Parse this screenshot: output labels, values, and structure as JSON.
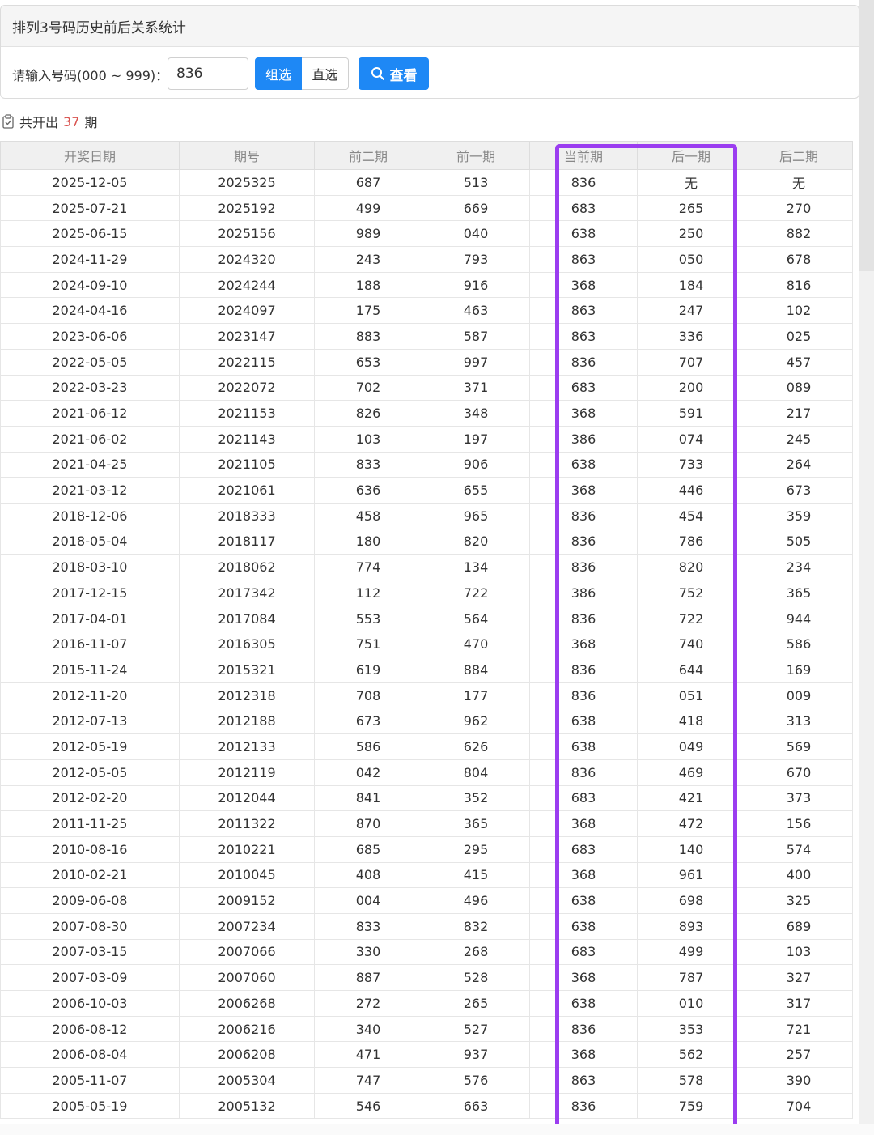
{
  "panel": {
    "title": "排列3号码历史前后关系统计",
    "search_label": "请输入号码(000 ~ 999)：",
    "search_value": "836",
    "modes": [
      "组选",
      "直选"
    ],
    "active_mode": "组选",
    "search_button": "查看",
    "search_icon": "search-icon"
  },
  "summary": {
    "prefix": "共开出",
    "count": "37",
    "suffix": "期",
    "icon": "clipboard-check-icon"
  },
  "colors": {
    "accent": "#1e88f5",
    "count": "#d9534f",
    "highlight": "#9b3df0"
  },
  "table": {
    "headers": [
      "开奖日期",
      "期号",
      "前二期",
      "前一期",
      "当前期",
      "后一期",
      "后二期"
    ],
    "rows": [
      [
        "2025-12-05",
        "2025325",
        "687",
        "513",
        "836",
        "无",
        "无"
      ],
      [
        "2025-07-21",
        "2025192",
        "499",
        "669",
        "683",
        "265",
        "270"
      ],
      [
        "2025-06-15",
        "2025156",
        "989",
        "040",
        "638",
        "250",
        "882"
      ],
      [
        "2024-11-29",
        "2024320",
        "243",
        "793",
        "863",
        "050",
        "678"
      ],
      [
        "2024-09-10",
        "2024244",
        "188",
        "916",
        "368",
        "184",
        "816"
      ],
      [
        "2024-04-16",
        "2024097",
        "175",
        "463",
        "863",
        "247",
        "102"
      ],
      [
        "2023-06-06",
        "2023147",
        "883",
        "587",
        "863",
        "336",
        "025"
      ],
      [
        "2022-05-05",
        "2022115",
        "653",
        "997",
        "836",
        "707",
        "457"
      ],
      [
        "2022-03-23",
        "2022072",
        "702",
        "371",
        "683",
        "200",
        "089"
      ],
      [
        "2021-06-12",
        "2021153",
        "826",
        "348",
        "368",
        "591",
        "217"
      ],
      [
        "2021-06-02",
        "2021143",
        "103",
        "197",
        "386",
        "074",
        "245"
      ],
      [
        "2021-04-25",
        "2021105",
        "833",
        "906",
        "638",
        "733",
        "264"
      ],
      [
        "2021-03-12",
        "2021061",
        "636",
        "655",
        "368",
        "446",
        "673"
      ],
      [
        "2018-12-06",
        "2018333",
        "458",
        "965",
        "836",
        "454",
        "359"
      ],
      [
        "2018-05-04",
        "2018117",
        "180",
        "820",
        "836",
        "786",
        "505"
      ],
      [
        "2018-03-10",
        "2018062",
        "774",
        "134",
        "836",
        "820",
        "234"
      ],
      [
        "2017-12-15",
        "2017342",
        "112",
        "722",
        "386",
        "752",
        "365"
      ],
      [
        "2017-04-01",
        "2017084",
        "553",
        "564",
        "836",
        "722",
        "944"
      ],
      [
        "2016-11-07",
        "2016305",
        "751",
        "470",
        "368",
        "740",
        "586"
      ],
      [
        "2015-11-24",
        "2015321",
        "619",
        "884",
        "836",
        "644",
        "169"
      ],
      [
        "2012-11-20",
        "2012318",
        "708",
        "177",
        "836",
        "051",
        "009"
      ],
      [
        "2012-07-13",
        "2012188",
        "673",
        "962",
        "638",
        "418",
        "313"
      ],
      [
        "2012-05-19",
        "2012133",
        "586",
        "626",
        "638",
        "049",
        "569"
      ],
      [
        "2012-05-05",
        "2012119",
        "042",
        "804",
        "836",
        "469",
        "670"
      ],
      [
        "2012-02-20",
        "2012044",
        "841",
        "352",
        "683",
        "421",
        "373"
      ],
      [
        "2011-11-25",
        "2011322",
        "870",
        "365",
        "368",
        "472",
        "156"
      ],
      [
        "2010-08-16",
        "2010221",
        "685",
        "295",
        "683",
        "140",
        "574"
      ],
      [
        "2010-02-21",
        "2010045",
        "408",
        "415",
        "368",
        "961",
        "400"
      ],
      [
        "2009-06-08",
        "2009152",
        "004",
        "496",
        "638",
        "698",
        "325"
      ],
      [
        "2007-08-30",
        "2007234",
        "833",
        "832",
        "638",
        "893",
        "689"
      ],
      [
        "2007-03-15",
        "2007066",
        "330",
        "268",
        "683",
        "499",
        "103"
      ],
      [
        "2007-03-09",
        "2007060",
        "887",
        "528",
        "368",
        "787",
        "327"
      ],
      [
        "2006-10-03",
        "2006268",
        "272",
        "265",
        "638",
        "010",
        "317"
      ],
      [
        "2006-08-12",
        "2006216",
        "340",
        "527",
        "836",
        "353",
        "721"
      ],
      [
        "2006-08-04",
        "2006208",
        "471",
        "937",
        "368",
        "562",
        "257"
      ],
      [
        "2005-11-07",
        "2005304",
        "747",
        "576",
        "863",
        "578",
        "390"
      ],
      [
        "2005-05-19",
        "2005132",
        "546",
        "663",
        "836",
        "759",
        "704"
      ]
    ]
  }
}
